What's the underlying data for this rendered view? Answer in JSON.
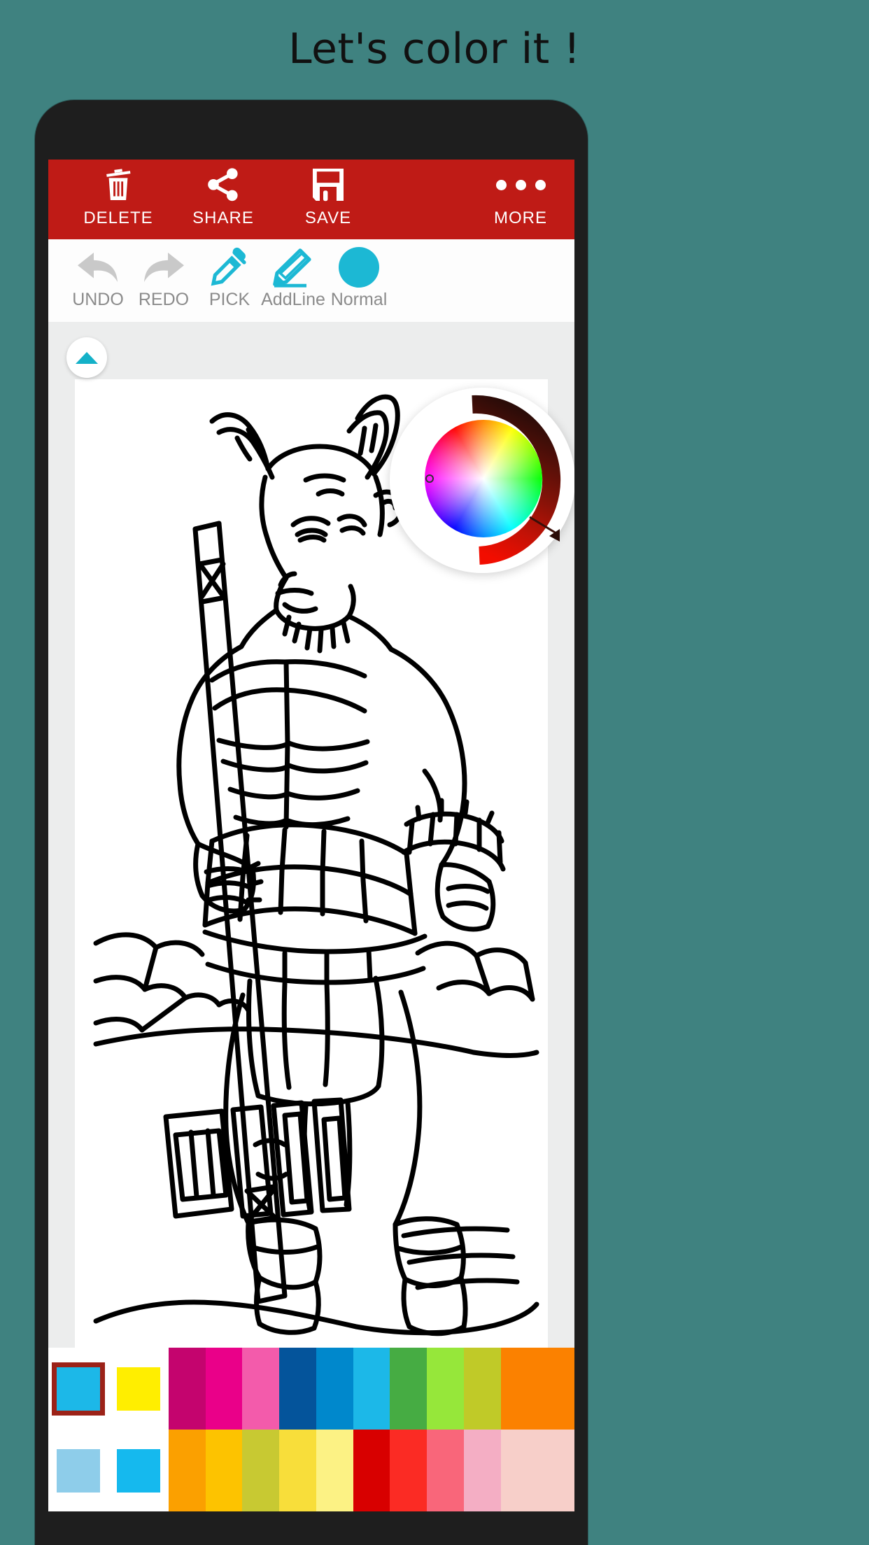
{
  "headline": "Let's color it !",
  "theme": {
    "page_background": "#3f8280",
    "phone_frame": "#1e1e1e",
    "action_bar": "#bf1b16",
    "accent": "#14b1c8",
    "canvas_background": "#eceded",
    "selection_border": "#9c2218"
  },
  "action_bar": {
    "buttons": [
      {
        "id": "delete",
        "label": "DELETE",
        "icon": "trash-icon"
      },
      {
        "id": "share",
        "label": "SHARE",
        "icon": "share-icon"
      },
      {
        "id": "save",
        "label": "SAVE",
        "icon": "floppy-disk-icon"
      },
      {
        "id": "more",
        "label": "MORE",
        "icon": "overflow-dots-icon"
      }
    ]
  },
  "tool_row": {
    "tools": [
      {
        "id": "undo",
        "label": "UNDO",
        "icon": "undo-arrow-icon",
        "color": "#c9c9c9",
        "enabled": false
      },
      {
        "id": "redo",
        "label": "REDO",
        "icon": "redo-arrow-icon",
        "color": "#c9c9c9",
        "enabled": false
      },
      {
        "id": "pick",
        "label": "PICK",
        "icon": "eyedropper-icon",
        "color": "#1cb8d4",
        "enabled": true
      },
      {
        "id": "addline",
        "label": "AddLine",
        "icon": "pencil-icon",
        "color": "#1cb8d4",
        "enabled": true
      },
      {
        "id": "normal",
        "label": "Normal",
        "icon": "color-dot-icon",
        "color": "#1cb8d4",
        "enabled": true
      }
    ]
  },
  "canvas": {
    "collapse_button_icon": "triangle-up-icon",
    "artwork_name": "minotaur-line-art",
    "artwork_description": "Black-and-white line drawing of a horned minotaur warrior holding a large hammer, standing on rocky ground"
  },
  "color_wheel": {
    "visible": true,
    "cursor_hue_position": "left-edge",
    "value_arc_from": "#2b0c08",
    "value_arc_to": "#f20d00",
    "arc_handle_icon": "arc-handle-triangle-icon"
  },
  "palette": {
    "selected_color": "#1cb8e8",
    "recent": [
      {
        "color": "#1cb8e8",
        "selected": true
      },
      {
        "color": "#ffee00",
        "selected": false
      },
      {
        "color": "#8ecdea",
        "selected": false
      },
      {
        "color": "#15b9ee",
        "selected": false
      }
    ],
    "grid_row_1": [
      "#c4046e",
      "#ea0089",
      "#f35bab",
      "#04549b",
      "#0088cc",
      "#1cb8e8",
      "#46ac43",
      "#96e73a",
      "#c0ca28",
      "#fb8100",
      "#fb8100"
    ],
    "grid_row_2": [
      "#fba000",
      "#fdc300",
      "#c8c932",
      "#f8de3a",
      "#fcf284",
      "#d80000",
      "#fb2b24",
      "#f9667a",
      "#f4aec4",
      "#f7cfc9",
      "#f7cfc9"
    ]
  }
}
